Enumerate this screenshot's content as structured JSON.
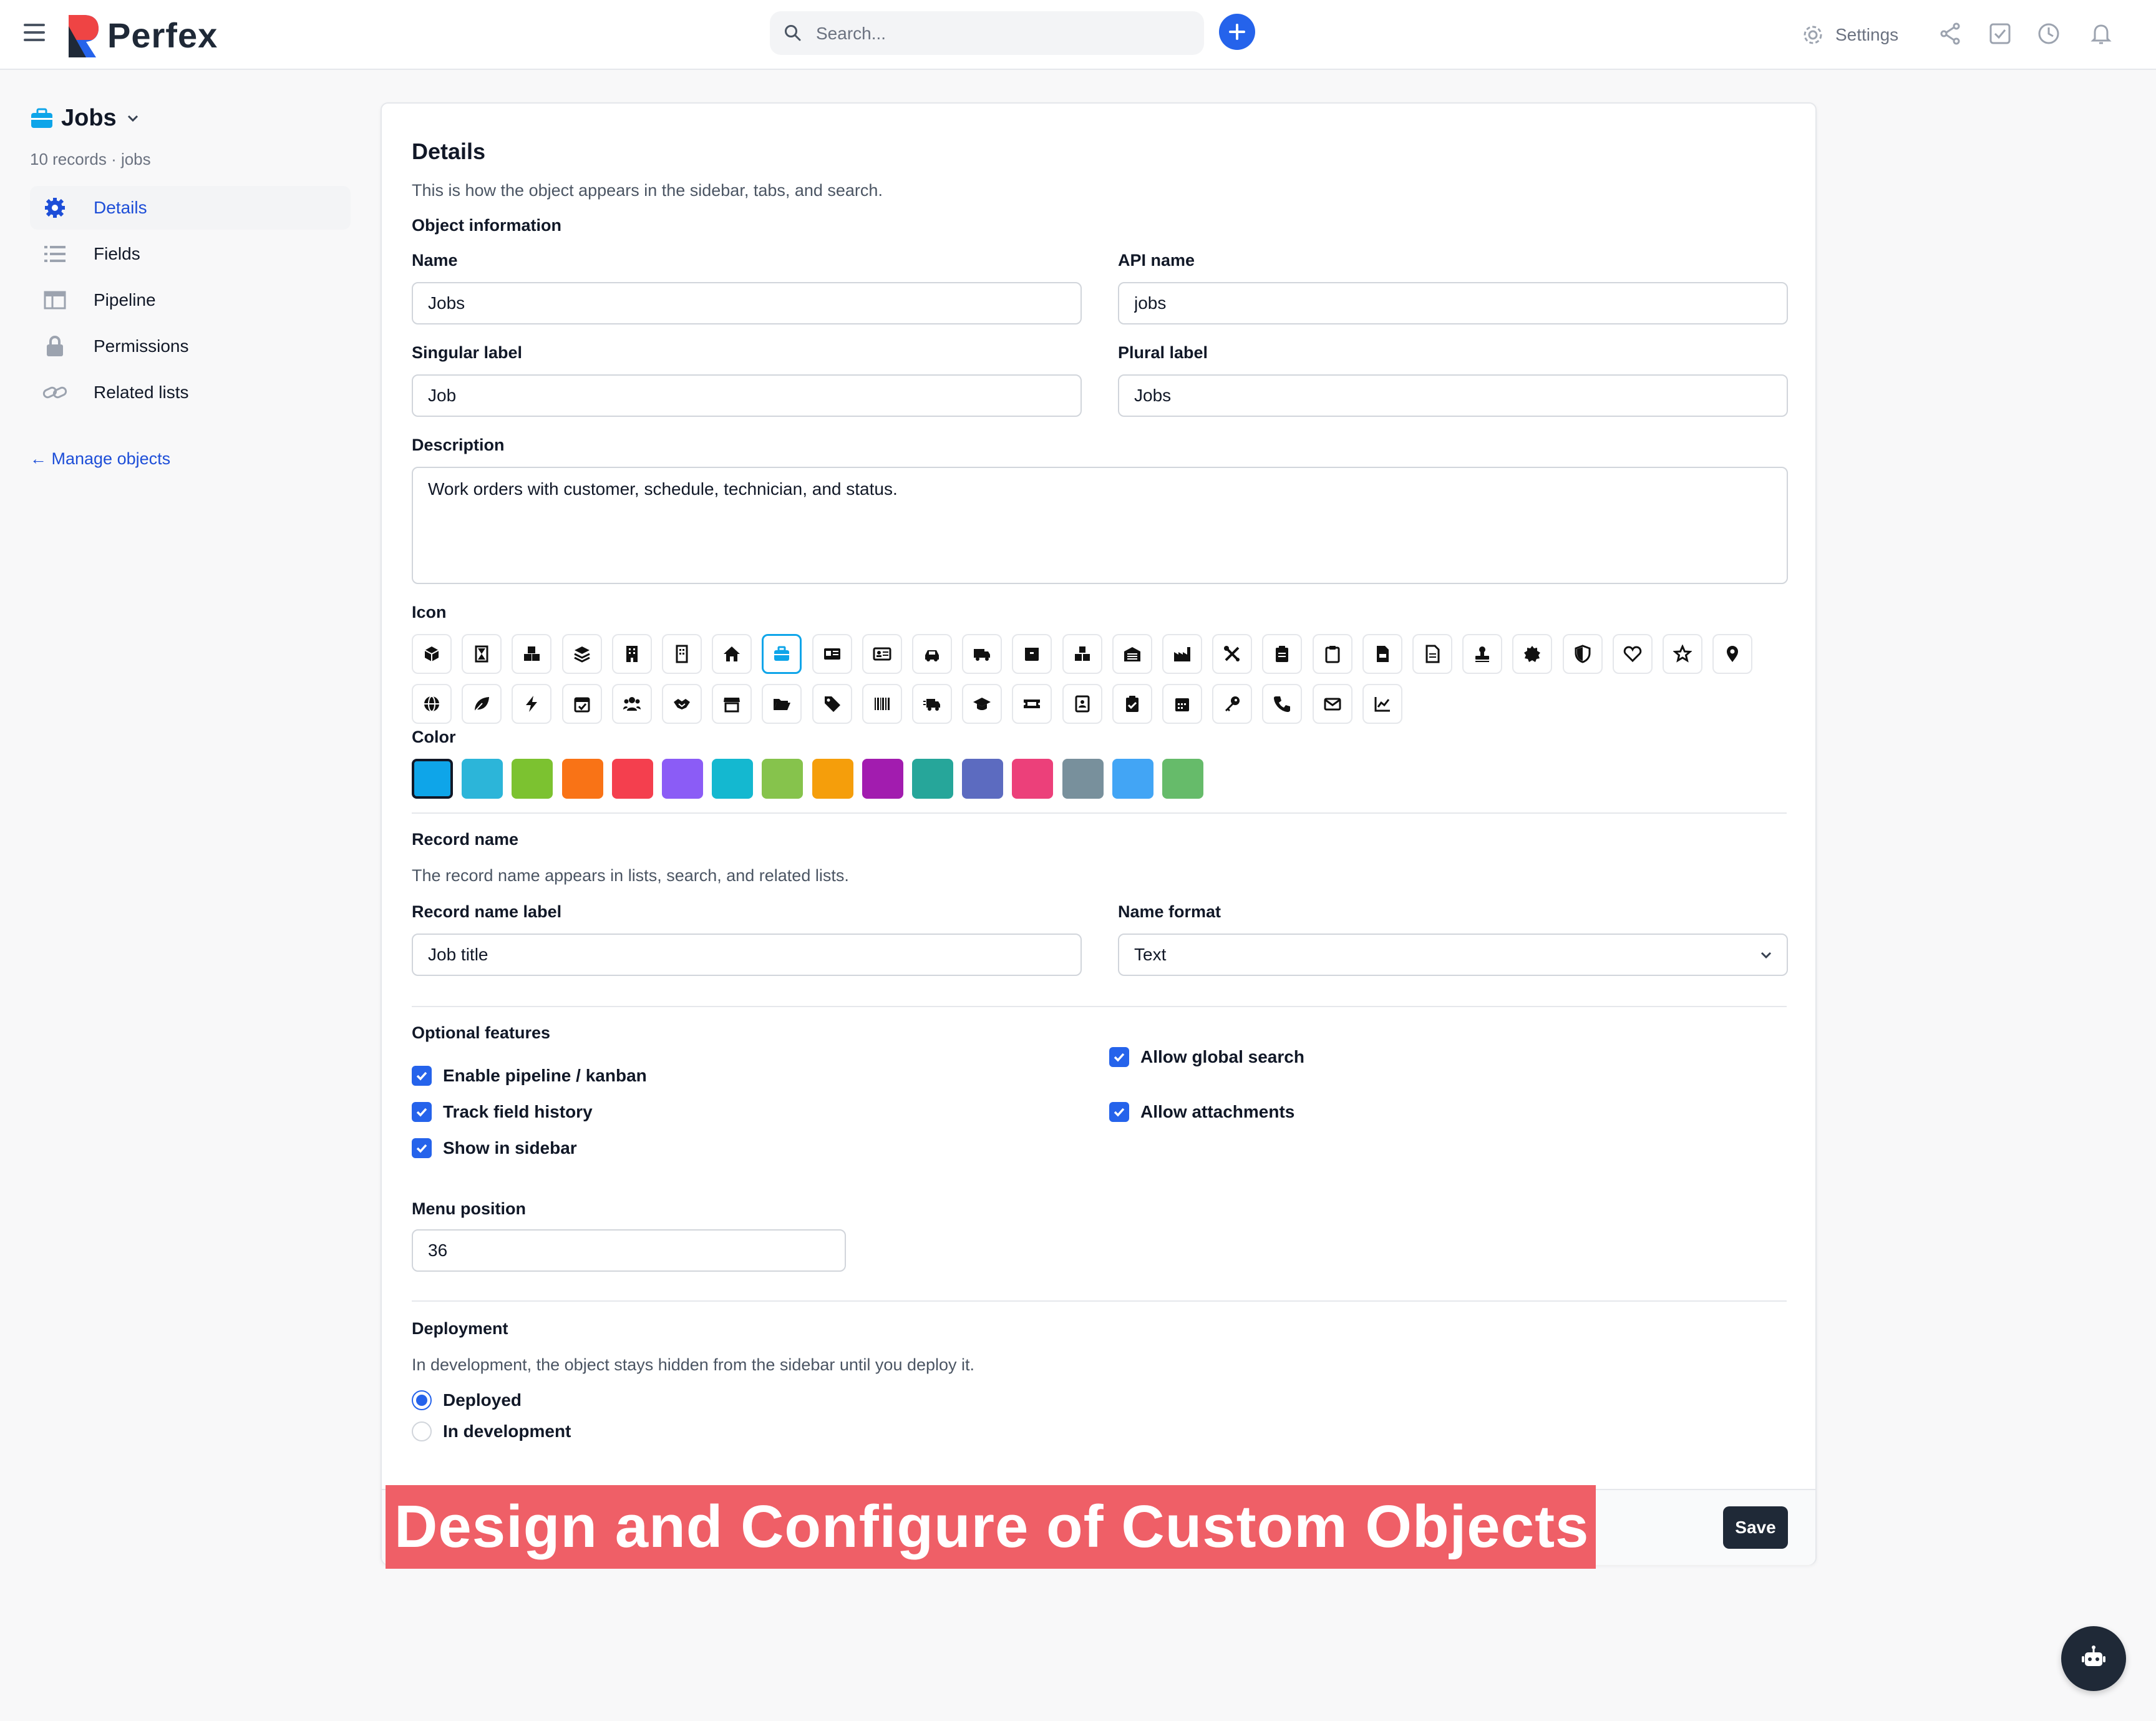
{
  "brand": {
    "name": "Perfex"
  },
  "topbar": {
    "search_placeholder": "Search...",
    "settings_label": "Settings",
    "icons": [
      "share-icon",
      "checkbox-icon",
      "clock-icon",
      "bell-icon"
    ]
  },
  "sidebar": {
    "object_name": "Jobs",
    "object_sub": "10 records · jobs",
    "items": [
      {
        "label": "Details",
        "icon": "gear-icon",
        "active": true
      },
      {
        "label": "Fields",
        "icon": "list-icon",
        "active": false
      },
      {
        "label": "Pipeline",
        "icon": "columns-icon",
        "active": false
      },
      {
        "label": "Permissions",
        "icon": "lock-icon",
        "active": false
      },
      {
        "label": "Related lists",
        "icon": "link-icon",
        "active": false
      }
    ],
    "manage_link": "← Manage objects"
  },
  "details": {
    "title": "Details",
    "help": "This is how the object appears in the sidebar, tabs, and search.",
    "object_info_heading": "Object information",
    "name_label": "Name",
    "name_value": "Jobs",
    "api_label": "API name",
    "api_value": "jobs",
    "singular_label": "Singular label",
    "singular_value": "Job",
    "plural_label": "Plural label",
    "plural_value": "Jobs",
    "description_label": "Description",
    "description_value": "Work orders with customer, schedule, technician, and status.",
    "icon_label": "Icon",
    "icons": [
      "cube",
      "hourglass",
      "cubes",
      "layers",
      "building",
      "office",
      "home",
      "briefcase",
      "id-card",
      "address-card",
      "car",
      "truck",
      "box",
      "boxes",
      "warehouse",
      "factory",
      "tools",
      "clipboard-list",
      "clipboard",
      "file-pdf",
      "file",
      "stamp",
      "badge",
      "shield",
      "heart",
      "star",
      "map-pin",
      "globe",
      "leaf",
      "bolt",
      "calendar-check",
      "users",
      "handshake",
      "store",
      "folder-open",
      "tag",
      "barcode",
      "truck-fast",
      "graduation-cap",
      "ticket",
      "contact-book",
      "clipboard-check",
      "calendar",
      "key",
      "phone",
      "envelope",
      "chart-line"
    ],
    "selected_icon": "briefcase",
    "color_label": "Color",
    "colors": [
      "#0ea5e9",
      "#2cb5d9",
      "#7cc230",
      "#f97316",
      "#f43f4e",
      "#8b5cf6",
      "#14b8d0",
      "#86c34c",
      "#f59e0b",
      "#a21caf",
      "#26a69a",
      "#5c6bc0",
      "#ec407a",
      "#78909c",
      "#42a5f5",
      "#66bb6a"
    ],
    "selected_color": "#0ea5e9"
  },
  "record_name": {
    "heading": "Record name",
    "help": "The record name appears in lists, search, and related lists.",
    "label_label": "Record name label",
    "label_value": "Job title",
    "format_label": "Name format",
    "format_value": "Text"
  },
  "features": {
    "heading": "Optional features",
    "left": [
      {
        "label": "Enable pipeline / kanban",
        "checked": true
      },
      {
        "label": "Track field history",
        "checked": true
      },
      {
        "label": "Show in sidebar",
        "checked": true
      }
    ],
    "right": [
      {
        "label": "Allow global search",
        "checked": true
      },
      {
        "label": "Allow attachments",
        "checked": true
      }
    ],
    "menu_position_label": "Menu position",
    "menu_position_value": "36"
  },
  "deployment": {
    "heading": "Deployment",
    "help": "In development, the object stays hidden from the sidebar until you deploy it.",
    "options": [
      {
        "label": "Deployed",
        "selected": true
      },
      {
        "label": "In development",
        "selected": false
      }
    ]
  },
  "footer": {
    "save_label": "Save"
  },
  "banner": {
    "text": "Design and Configure of Custom Objects"
  }
}
